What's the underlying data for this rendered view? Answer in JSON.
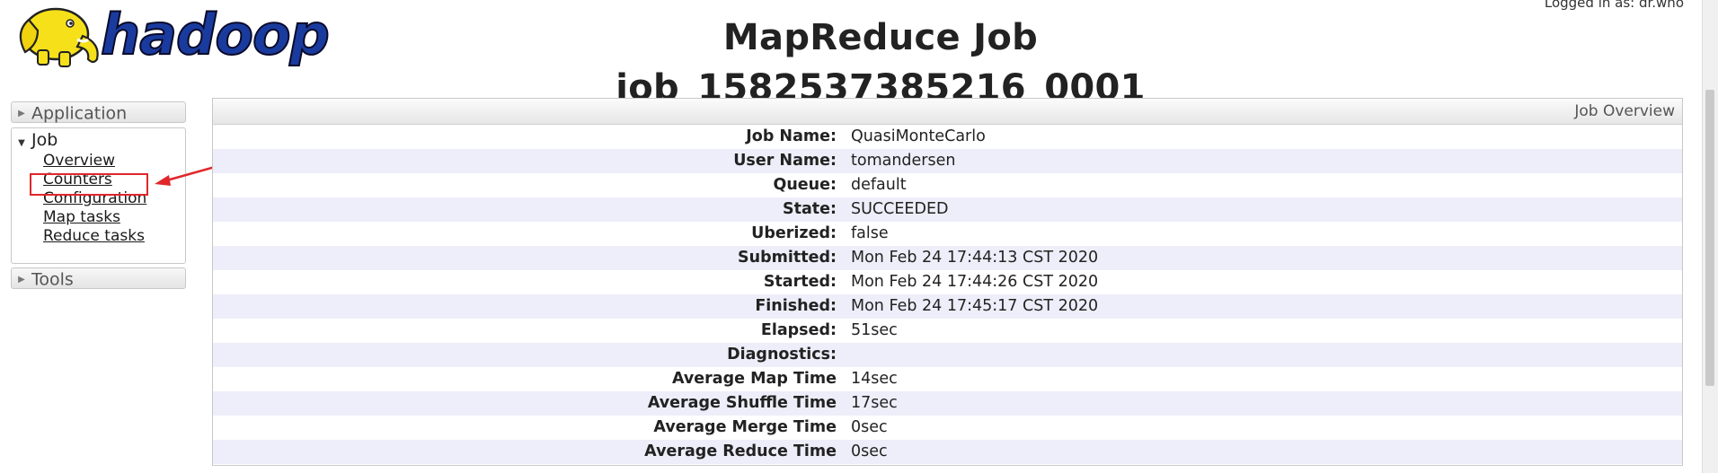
{
  "header": {
    "logo_text": "hadoop",
    "title": "MapReduce Job job_1582537385216_0001",
    "logged_in": "Logged in as: dr.who"
  },
  "sidebar": {
    "application_label": "Application",
    "job": {
      "label": "Job",
      "links": [
        "Overview",
        "Counters",
        "Configuration",
        "Map tasks",
        "Reduce tasks"
      ]
    },
    "tools_label": "Tools"
  },
  "annotation": {
    "highlight_color": "#e0272b",
    "highlighted_item": "Counters"
  },
  "overview": {
    "header": "Job Overview",
    "rows": [
      {
        "label": "Job Name:",
        "value": "QuasiMonteCarlo"
      },
      {
        "label": "User Name:",
        "value": "tomandersen"
      },
      {
        "label": "Queue:",
        "value": "default"
      },
      {
        "label": "State:",
        "value": "SUCCEEDED"
      },
      {
        "label": "Uberized:",
        "value": "false"
      },
      {
        "label": "Submitted:",
        "value": "Mon Feb 24 17:44:13 CST 2020"
      },
      {
        "label": "Started:",
        "value": "Mon Feb 24 17:44:26 CST 2020"
      },
      {
        "label": "Finished:",
        "value": "Mon Feb 24 17:45:17 CST 2020"
      },
      {
        "label": "Elapsed:",
        "value": "51sec"
      },
      {
        "label": "Diagnostics:",
        "value": ""
      },
      {
        "label": "Average Map Time",
        "value": "14sec"
      },
      {
        "label": "Average Shuffle Time",
        "value": "17sec"
      },
      {
        "label": "Average Merge Time",
        "value": "0sec"
      },
      {
        "label": "Average Reduce Time",
        "value": "0sec"
      }
    ]
  }
}
